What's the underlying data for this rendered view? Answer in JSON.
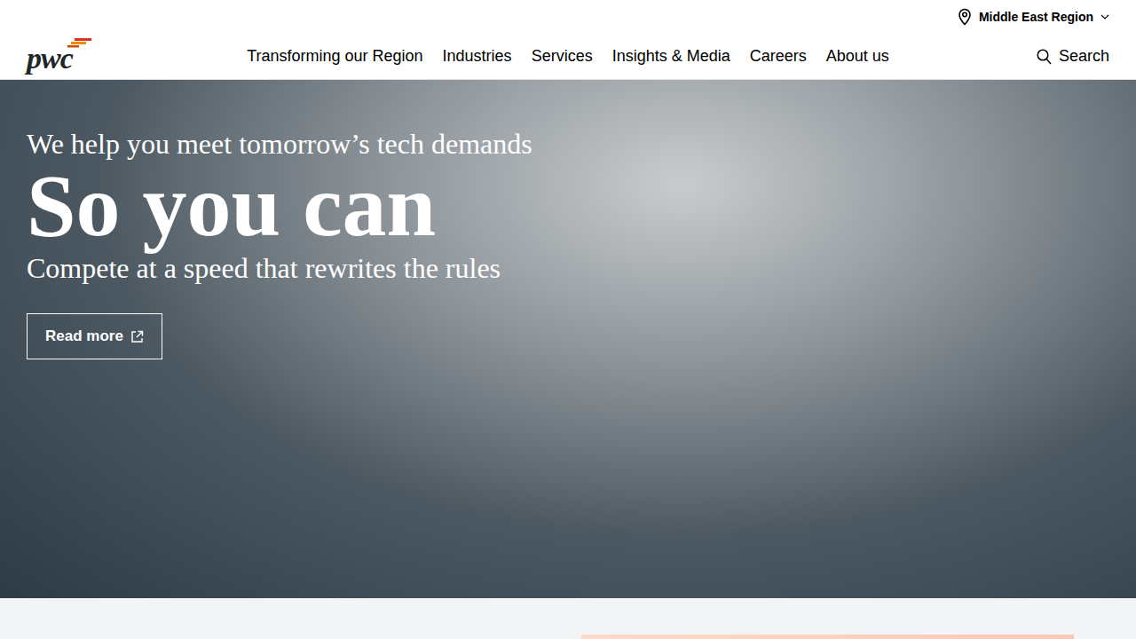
{
  "region": {
    "label": "Middle East Region"
  },
  "logo": {
    "text": "pwc"
  },
  "nav": [
    "Transforming our Region",
    "Industries",
    "Services",
    "Insights & Media",
    "Careers",
    "About us"
  ],
  "search": {
    "label": "Search"
  },
  "hero": {
    "kicker": "We help you meet tomorrow’s tech demands",
    "headline": "So you can",
    "subhead": "Compete at a speed that rewrites the rules",
    "button": "Read more"
  }
}
